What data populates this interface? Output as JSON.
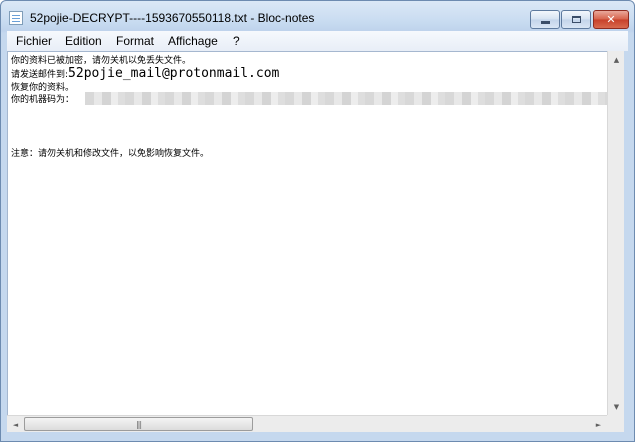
{
  "window": {
    "title": "52pojie-DECRYPT----1593670550118.txt - Bloc-notes",
    "controls": {
      "minimize": "–",
      "maximize": "□",
      "close": "✕"
    }
  },
  "menubar": {
    "items": [
      "Fichier",
      "Edition",
      "Format",
      "Affichage",
      "?"
    ]
  },
  "editor": {
    "lines": [
      "你的资料已被加密，请勿关机以免丢失文件。",
      "请发送邮件到:",
      "52pojie_mail@protonmail.com",
      "恢复你的资料。",
      "你的机器码为：",
      "注意：请勿关机和修改文件，以免影响恢复文件。"
    ]
  },
  "scrollbars": {
    "up_arrow": "▲",
    "down_arrow": "▼",
    "left_arrow": "◄",
    "right_arrow": "►",
    "thumb_grip": "|||"
  }
}
